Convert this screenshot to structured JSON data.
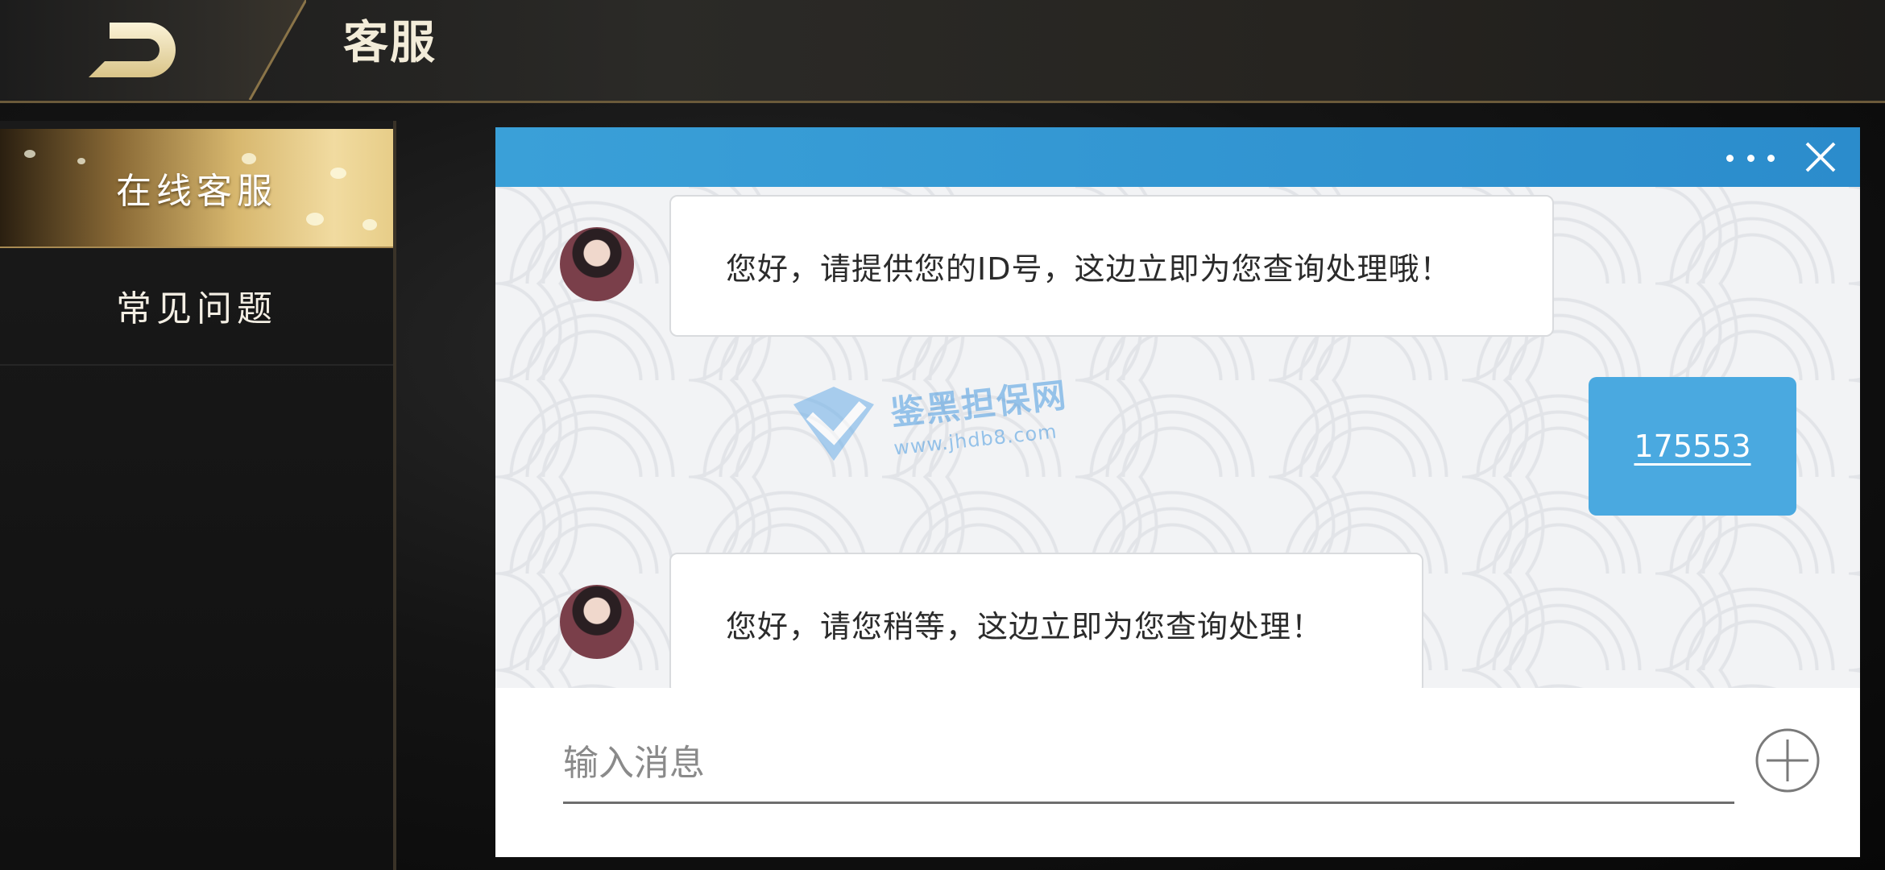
{
  "header": {
    "title": "客服",
    "back_icon": "back-arrow-icon"
  },
  "sidebar": {
    "items": [
      {
        "label": "在线客服",
        "active": true
      },
      {
        "label": "常见问题",
        "active": false
      }
    ]
  },
  "chat": {
    "topbar_color": "#2b8ccc",
    "menu_icon": "more-dots-icon",
    "close_icon": "close-icon",
    "messages": [
      {
        "from": "agent",
        "text": "您好，请提供您的ID号，这边立即为您查询处理哦！"
      },
      {
        "from": "user",
        "text": "175553"
      },
      {
        "from": "agent",
        "text": "您好，请您稍等，这边立即为您查询处理！"
      }
    ],
    "watermark": {
      "title": "鉴黑担保网",
      "url": "www.jhdb8.com"
    },
    "input": {
      "placeholder": "输入消息",
      "value": ""
    },
    "add_icon": "plus-circle-icon"
  },
  "colors": {
    "accent_gold": "#d7b76e",
    "user_bubble": "#4aa9e0",
    "header_bar": "#2b8ccc"
  }
}
